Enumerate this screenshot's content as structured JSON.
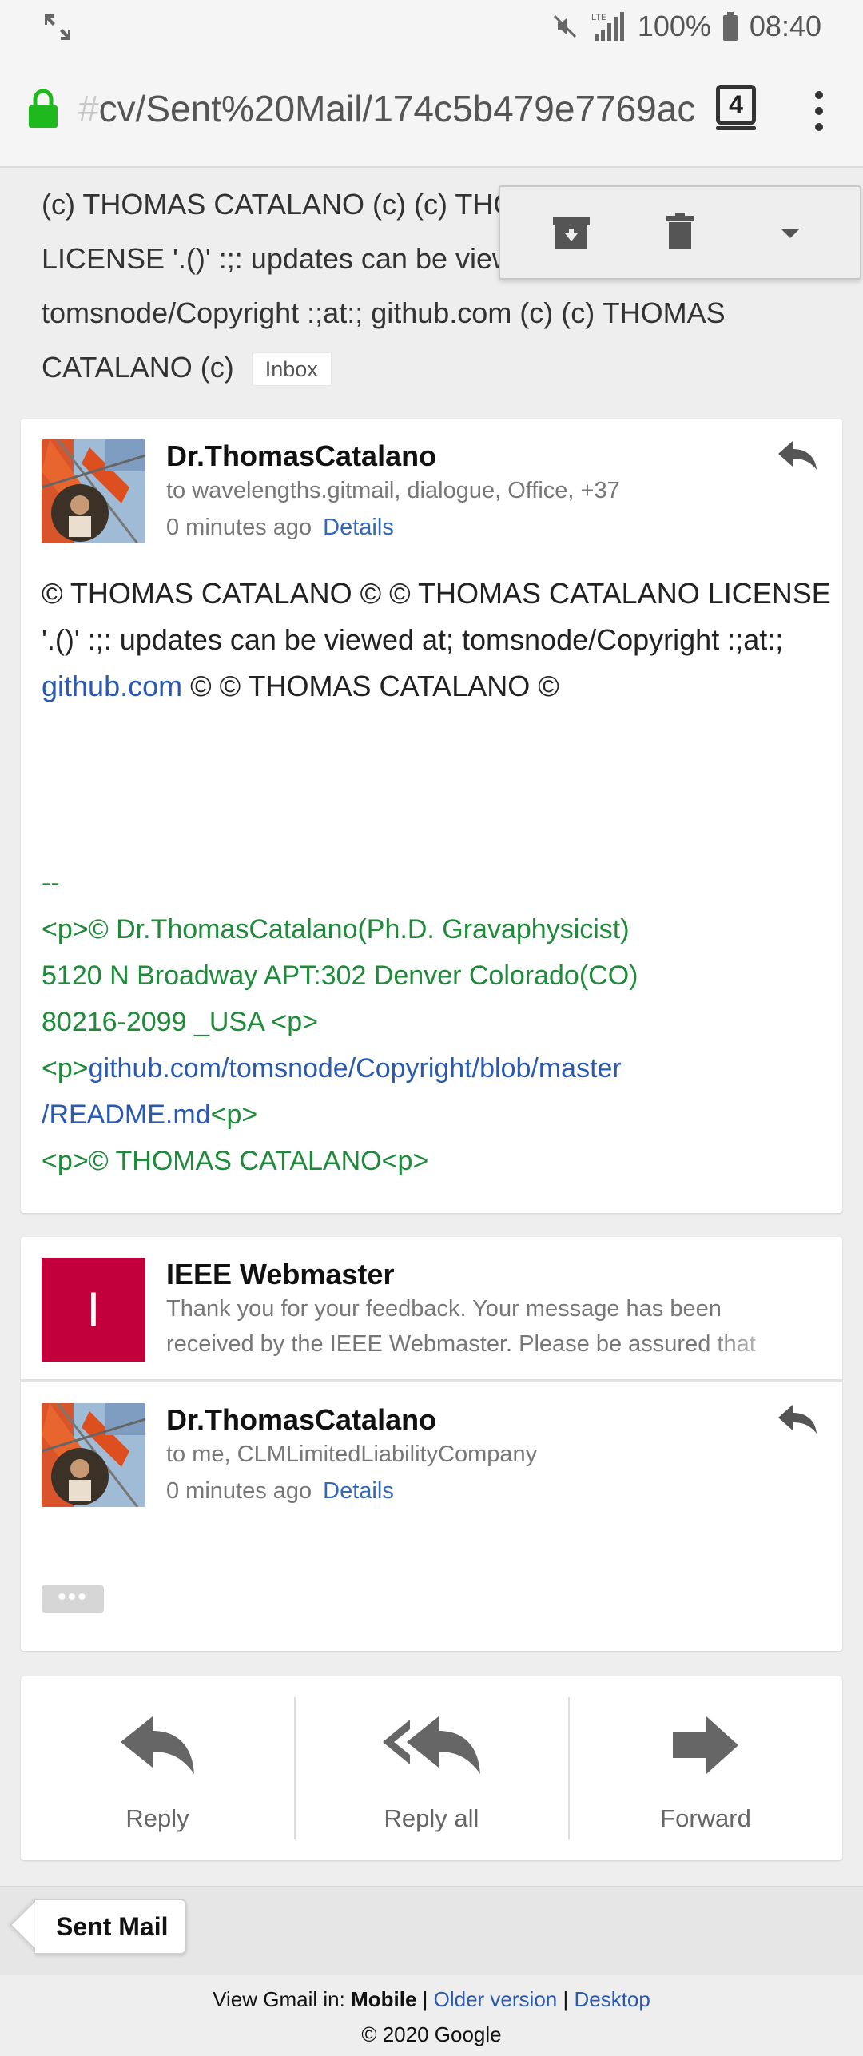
{
  "status_bar": {
    "battery": "100%",
    "time": "08:40",
    "network": "LTE",
    "icons": [
      "screen-expand-icon",
      "mute-icon",
      "signal-icon",
      "battery-icon"
    ]
  },
  "browser": {
    "url_faded": "#",
    "url": "cv/Sent%20Mail/174c5b479e7769ac",
    "tab_count": "4"
  },
  "thread": {
    "subject": "(c) THOMAS CATALANO (c) (c) THOMAS CATALANO LICENSE '.()' :;: updates can be viewed at; tomsnode/Copyright :;at:; github.com (c) (c) THOMAS CATALANO (c)",
    "subject_line1": "(c) THOMAS CATALANO (c) (c) THO",
    "subject_line2": "LICENSE '.()' :;: updates can be viewe",
    "subject_line3": "tomsnode/Copyright :;at:; github.com (c) (c) THOMAS",
    "subject_line4": "CATALANO (c)",
    "label": "Inbox"
  },
  "messages": [
    {
      "sender": "Dr.ThomasCatalano",
      "recipients": "to wavelengths.gitmail, dialogue, Office, +37",
      "time": "0 minutes ago",
      "details_link": "Details",
      "body_line1": "© THOMAS CATALANO ©  © THOMAS CATALANO LICENSE",
      "body_line2": "'.()' :;: updates can be viewed at; tomsnode/Copyright :;at:;",
      "body_link": "github.com",
      "body_line3_rest": " ©  © THOMAS CATALANO ©",
      "sig_dashes": "--",
      "sig_line1": "<p>© Dr.ThomasCatalano(Ph.D. Gravaphysicist)",
      "sig_line2": "5120 N Broadway APT:302 Denver Colorado(CO)",
      "sig_line3": "80216-2099 _USA <p>",
      "sig_line4_prefix": "<p>",
      "sig_line4_link": "github.com/tomsnode/Copyright/blob/master",
      "sig_line5_link": "/README.md",
      "sig_line5_suffix": "<p>",
      "sig_line6": "<p>© THOMAS CATALANO<p>"
    },
    {
      "avatar_letter": "I",
      "sender": "IEEE Webmaster",
      "snippet_line1": "Thank you for your feedback. Your message has been",
      "snippet_line2": "received by the IEEE Webmaster. Please be assured that"
    },
    {
      "sender": "Dr.ThomasCatalano",
      "recipients": "to me, CLMLimitedLiabilityCompany",
      "time": "0 minutes ago",
      "details_link": "Details",
      "ellipsis": "•••"
    }
  ],
  "actions": {
    "reply": "Reply",
    "reply_all": "Reply all",
    "forward": "Forward"
  },
  "folder_tag": "Sent Mail",
  "footer": {
    "view_prefix": "View Gmail in: ",
    "mobile": "Mobile",
    "sep": " | ",
    "older": "Older version",
    "desktop": "Desktop",
    "copyright": "© 2020 Google"
  },
  "colors": {
    "accent_link": "#2a5ab0",
    "signature_green": "#1e8a3a",
    "ieee_avatar": "#c2003c",
    "lock_green": "#1db91d"
  }
}
